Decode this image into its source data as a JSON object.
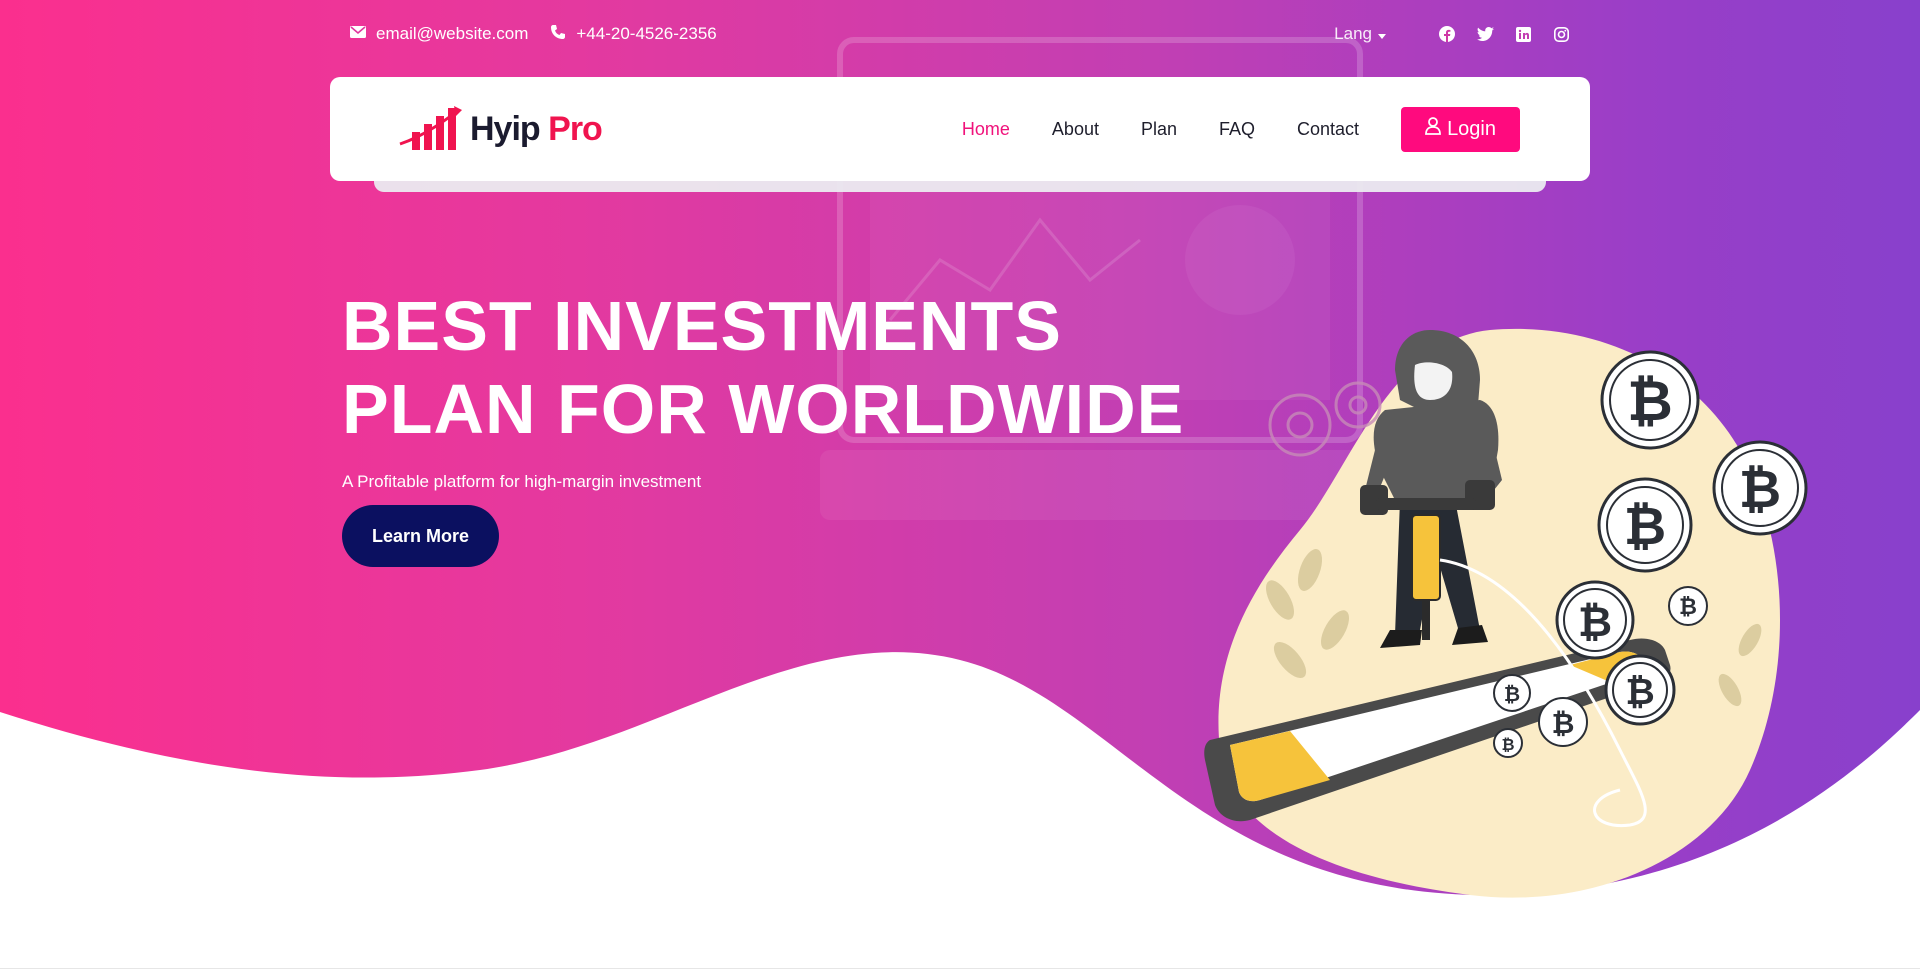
{
  "topbar": {
    "email": "email@website.com",
    "phone": "+44-20-4526-2356",
    "lang_label": "Lang",
    "social_icons": [
      "facebook-icon",
      "twitter-icon",
      "linkedin-icon",
      "instagram-icon"
    ]
  },
  "brand": {
    "name_part1": "Hyip",
    "name_part2": "Pro"
  },
  "nav": {
    "items": [
      {
        "label": "Home",
        "active": true
      },
      {
        "label": "About"
      },
      {
        "label": "Plan"
      },
      {
        "label": "FAQ"
      },
      {
        "label": "Contact"
      }
    ],
    "login_label": "Login"
  },
  "hero": {
    "title_line1": "BEST INVESTMENTS",
    "title_line2": "PLAN FOR WORLDWIDE",
    "subtitle": "A Profitable platform for high-margin investment",
    "cta_label": "Learn More"
  },
  "colors": {
    "accent": "#ff0a7e",
    "active_nav": "#f0127b",
    "cta_bg": "#0b1060",
    "gradient_start": "#fb2f8e",
    "gradient_end": "#8840cc"
  }
}
